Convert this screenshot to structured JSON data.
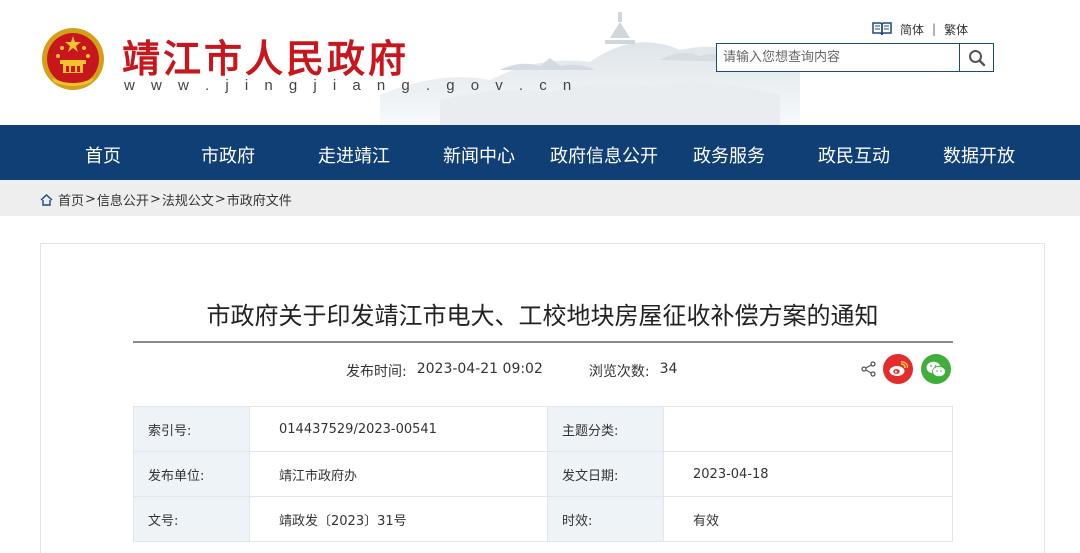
{
  "header": {
    "site_title": "靖江市人民政府",
    "site_url": "w w w . j i n g j i a n g . g o v . c n",
    "lang": {
      "simplified": "简体",
      "separator": "|",
      "traditional": "繁体"
    },
    "search": {
      "placeholder": "请输入您想查询内容"
    },
    "colors": {
      "brand_red": "#c8161d",
      "nav_blue": "#0f3f74"
    }
  },
  "nav": {
    "items": [
      "首页",
      "市政府",
      "走进靖江",
      "新闻中心",
      "政府信息公开",
      "政务服务",
      "政民互动",
      "数据开放"
    ]
  },
  "breadcrumb": {
    "items": [
      "首页",
      "信息公开",
      "法规公文",
      "市政府文件"
    ],
    "separator": ">"
  },
  "article": {
    "title": "市政府关于印发靖江市电大、工校地块房屋征收补偿方案的通知",
    "publish_label": "发布时间:",
    "publish_time": "2023-04-21 09:02",
    "views_label": "浏览次数:",
    "views": "34",
    "share_icons": [
      "share-icon",
      "weibo-icon",
      "wechat-icon"
    ],
    "info": {
      "rows": [
        {
          "k1": "索引号:",
          "v1": "014437529/2023-00541",
          "k2": "主题分类:",
          "v2": ""
        },
        {
          "k1": "发布单位:",
          "v1": "靖江市政府办",
          "k2": "发文日期:",
          "v2": "2023-04-18"
        },
        {
          "k1": "文号:",
          "v1": "靖政发〔2023〕31号",
          "k2": "时效:",
          "v2": "有效"
        }
      ]
    }
  }
}
